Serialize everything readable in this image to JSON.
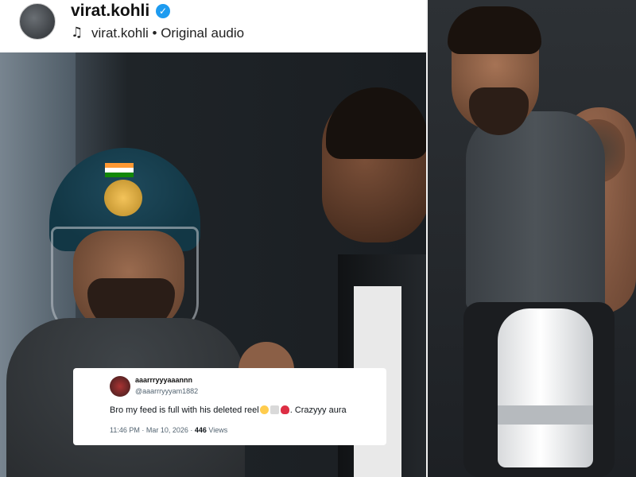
{
  "header": {
    "username": "virat.kohli",
    "verified_icon": "verified-badge-icon",
    "music_icon": "music-note-icon",
    "audio_label": "virat.kohli • Original audio"
  },
  "tweet": {
    "display_name": "aaarrryyyaaannn",
    "handle": "@aaarrryyyam1882",
    "text_before_emoji": "Bro my feed is full with his deleted reel",
    "emojis": [
      "crying-face-emoji",
      "goat-emoji",
      "red-heart-emoji"
    ],
    "text_after_emoji": ". Crazyyy aura",
    "timestamp": "11:46 PM · Mar 10, 2026 · ",
    "views_count": "446",
    "views_label": " Views"
  },
  "colors": {
    "verified": "#1d9bf0",
    "helmet": "#123745",
    "flag_saffron": "#ff9933",
    "flag_green": "#138808",
    "heart": "#dd2e44"
  }
}
